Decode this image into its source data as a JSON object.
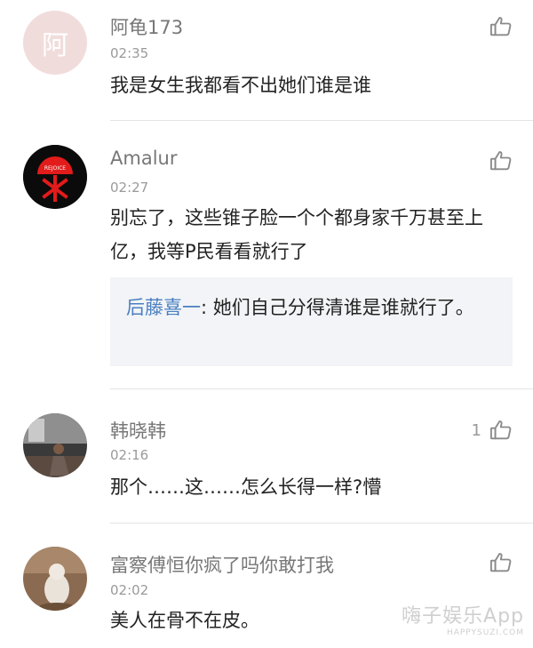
{
  "comments": [
    {
      "avatar_text": "阿",
      "username": "阿龟173",
      "time": "02:35",
      "text": "我是女生我都看不出她们谁是谁",
      "likes": ""
    },
    {
      "avatar_badge": "REJOICE",
      "username": "Amalur",
      "time": "02:27",
      "text": "别忘了，这些锥子脸一个个都身家千万甚至上亿，我等P民看看就行了",
      "reply": {
        "name": "后藤喜一",
        "separator": ":",
        "text": "她们自己分得清谁是谁就行了。"
      },
      "likes": ""
    },
    {
      "username": "韩晓韩",
      "time": "02:16",
      "text": "那个……这……怎么长得一样?懵",
      "likes": "1"
    },
    {
      "username": "富察傅恒你疯了吗你敢打我",
      "time": "02:02",
      "text": "美人在骨不在皮。",
      "likes": ""
    }
  ],
  "watermark": {
    "main": "嗨子娱乐App",
    "sub": "HAPPYSUZI.COM"
  },
  "colors": {
    "username": "#777777",
    "reply_name": "#4a7fc0",
    "reply_bg": "#f2f4f7"
  }
}
